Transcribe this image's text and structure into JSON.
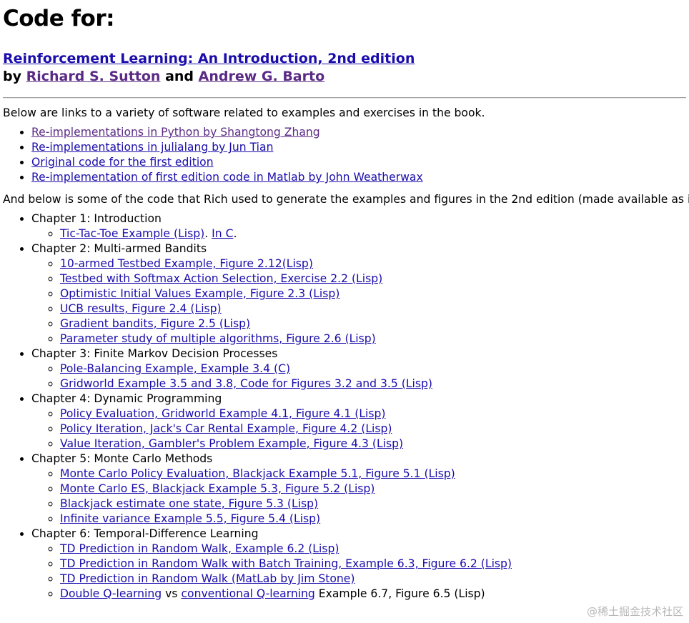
{
  "title": "Code for:",
  "book": {
    "title": "Reinforcement Learning: An Introduction, 2nd edition",
    "by": "by",
    "author1": "Richard S. Sutton",
    "and": "and",
    "author2": "Andrew G. Barto"
  },
  "intro": "Below are links to a variety of software related to examples and exercises in the book.",
  "links": [
    "Re-implementations in Python by Shangtong Zhang",
    "Re-implementations in julialang by Jun Tian",
    "Original code for the first edition",
    "Re-implementation of first edition code in Matlab by John Weatherwax"
  ],
  "intro2": "And below is some of the code that Rich used to generate the examples and figures in the 2nd edition (made available as is):",
  "chapters": [
    {
      "title": "Chapter 1: Introduction",
      "items": [
        {
          "link": "Tic-Tac-Toe Example (Lisp)",
          "sep": ". ",
          "link2": "In C",
          "tail": "."
        }
      ]
    },
    {
      "title": "Chapter 2: Multi-armed Bandits",
      "items": [
        {
          "link": "10-armed Testbed Example, Figure 2.12(Lisp)"
        },
        {
          "link": "Testbed with Softmax Action Selection, Exercise 2.2 (Lisp)"
        },
        {
          "link": "Optimistic Initial Values Example, Figure 2.3 (Lisp)"
        },
        {
          "link": "UCB results, Figure 2.4 (Lisp)"
        },
        {
          "link": "Gradient bandits, Figure 2.5 (Lisp)"
        },
        {
          "link": "Parameter study of multiple algorithms, Figure 2.6 (Lisp)"
        }
      ]
    },
    {
      "title": "Chapter 3: Finite Markov Decision Processes",
      "items": [
        {
          "link": "Pole-Balancing Example, Example 3.4 (C)"
        },
        {
          "link": "Gridworld Example 3.5 and 3.8, Code for Figures 3.2 and 3.5 (Lisp)"
        }
      ]
    },
    {
      "title": "Chapter 4: Dynamic Programming",
      "items": [
        {
          "link": "Policy Evaluation, Gridworld Example 4.1, Figure 4.1 (Lisp)"
        },
        {
          "link": "Policy Iteration, Jack's Car Rental Example, Figure 4.2 (Lisp)"
        },
        {
          "link": "Value Iteration, Gambler's Problem Example, Figure 4.3 (Lisp)"
        }
      ]
    },
    {
      "title": "Chapter 5: Monte Carlo Methods",
      "items": [
        {
          "link": "Monte Carlo Policy Evaluation, Blackjack Example 5.1, Figure 5.1 (Lisp)"
        },
        {
          "link": "Monte Carlo ES, Blackjack Example 5.3, Figure 5.2 (Lisp)"
        },
        {
          "link": "Blackjack estimate one state, Figure 5.3 (Lisp)"
        },
        {
          "link": "Infinite variance Example 5.5, Figure 5.4 (Lisp)"
        }
      ]
    },
    {
      "title": "Chapter 6: Temporal-Difference Learning",
      "items": [
        {
          "link": "TD Prediction in Random Walk, Example 6.2 (Lisp)"
        },
        {
          "link": "TD Prediction in Random Walk with Batch Training, Example 6.3, Figure 6.2 (Lisp)"
        },
        {
          "link": "TD Prediction in Random Walk (MatLab by Jim Stone)"
        },
        {
          "link": "Double Q-learning",
          "sep": " vs ",
          "link2": "conventional Q-learning",
          "tail": " Example 6.7, Figure 6.5 (Lisp)"
        }
      ]
    }
  ],
  "watermark": "@稀土掘金技术社区"
}
